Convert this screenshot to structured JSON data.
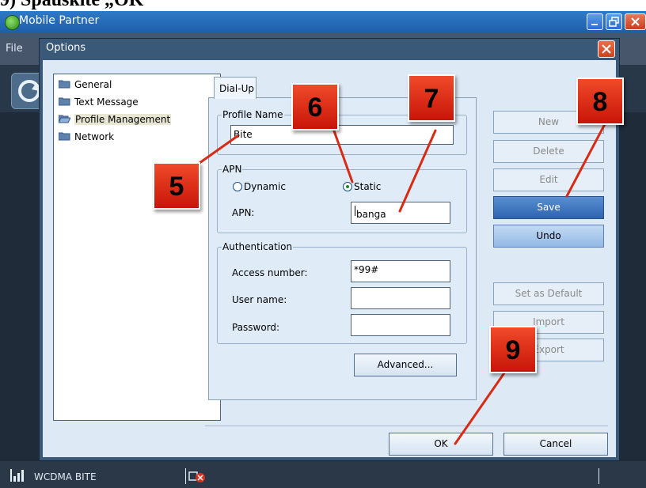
{
  "caption": "9) Spauskite „OK",
  "window": {
    "title": "Mobile Partner",
    "menu_file": "File"
  },
  "status": {
    "network": "WCDMA BITE"
  },
  "dialog": {
    "title": "Options",
    "tree": [
      "General",
      "Text Message",
      "Profile Management",
      "Network"
    ],
    "selected_tree_item": "Profile Management",
    "tab": "Dial-Up",
    "profile_name": {
      "legend": "Profile Name",
      "value": "Bite"
    },
    "apn": {
      "legend": "APN",
      "dynamic_label": "Dynamic",
      "static_label": "Static",
      "selected": "Static",
      "apn_label": "APN:",
      "apn_value": "banga"
    },
    "auth": {
      "legend": "Authentication",
      "access_label": "Access number:",
      "access_value": "*99#",
      "user_label": "User name:",
      "user_value": "",
      "password_label": "Password:",
      "password_value": ""
    },
    "advanced_button": "Advanced...",
    "side_buttons": {
      "new": "New",
      "delete": "Delete",
      "edit": "Edit",
      "save": "Save",
      "undo": "Undo",
      "set_default": "Set as Default",
      "import": "Import",
      "export": "Export"
    },
    "ok_button": "OK",
    "cancel_button": "Cancel"
  },
  "callouts": [
    "5",
    "6",
    "7",
    "8",
    "9"
  ],
  "colors": {
    "callout": "#e0301a",
    "accent": "#2d64b0",
    "dialog_bg": "#dde9f5"
  }
}
